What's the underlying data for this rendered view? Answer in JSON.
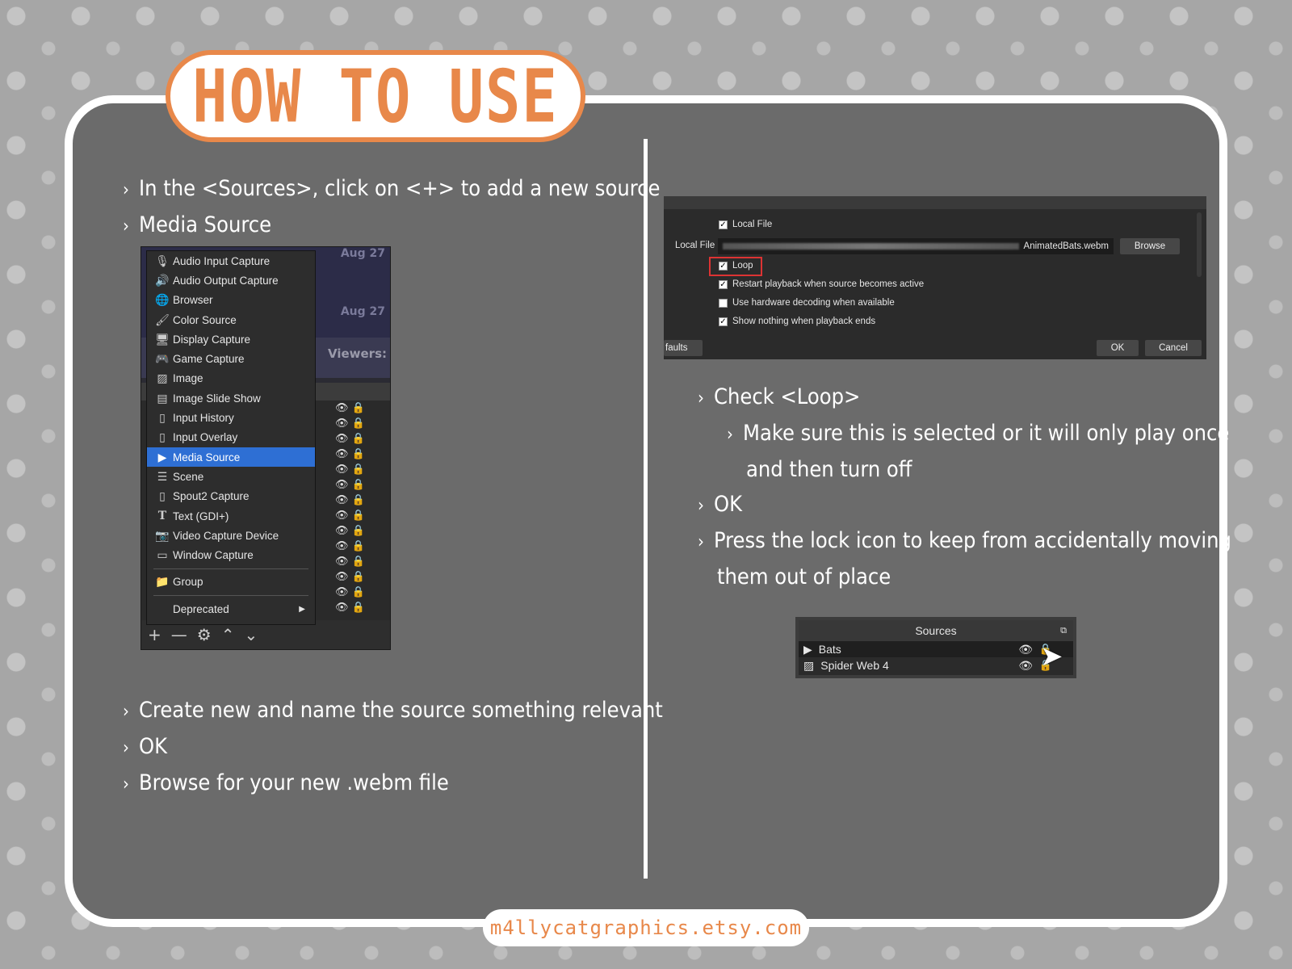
{
  "header": {
    "title": "HOW TO USE"
  },
  "colors": {
    "accent": "#e8884a",
    "panel": "#6b6b6b",
    "selection": "#2e6fd4",
    "highlight_box": "#d33333"
  },
  "left_steps_top": [
    "In the <Sources>, click on <+> to add a new source",
    "Media Source"
  ],
  "left_steps_bottom": [
    "Create new and name the source something relevant",
    "OK",
    "Browse for your new .webm file"
  ],
  "menu_shot": {
    "dates": [
      "Aug 27",
      "Aug 27"
    ],
    "viewers_label": "Viewers:",
    "items": [
      {
        "label": "Audio Input Capture",
        "icon": "microphone-icon"
      },
      {
        "label": "Audio Output Capture",
        "icon": "speaker-icon"
      },
      {
        "label": "Browser",
        "icon": "globe-icon"
      },
      {
        "label": "Color Source",
        "icon": "brush-icon"
      },
      {
        "label": "Display Capture",
        "icon": "monitor-icon"
      },
      {
        "label": "Game Capture",
        "icon": "gamepad-icon"
      },
      {
        "label": "Image",
        "icon": "image-icon"
      },
      {
        "label": "Image Slide Show",
        "icon": "slideshow-icon"
      },
      {
        "label": "Input History",
        "icon": "file-icon"
      },
      {
        "label": "Input Overlay",
        "icon": "file-icon"
      },
      {
        "label": "Media Source",
        "icon": "play-icon",
        "selected": true
      },
      {
        "label": "Scene",
        "icon": "list-icon"
      },
      {
        "label": "Spout2 Capture",
        "icon": "file-icon"
      },
      {
        "label": "Text (GDI+)",
        "icon": "text-icon"
      },
      {
        "label": "Video Capture Device",
        "icon": "camera-icon"
      },
      {
        "label": "Window Capture",
        "icon": "window-icon"
      }
    ],
    "group_label": "Group",
    "deprecated_label": "Deprecated"
  },
  "props_shot": {
    "local_file_checkbox": "Local File",
    "local_file_label": "Local File",
    "file_name": "AnimatedBats.webm",
    "browse_label": "Browse",
    "loop_label": "Loop",
    "restart_label": "Restart playback when source becomes active",
    "hw_decode_label": "Use hardware decoding when available",
    "show_nothing_label": "Show nothing when playback ends",
    "defaults_label": "faults",
    "ok_label": "OK",
    "cancel_label": "Cancel",
    "checked": {
      "local_file": true,
      "loop": true,
      "restart": true,
      "hw_decode": false,
      "show_nothing": true
    }
  },
  "right_steps": [
    {
      "text": "Check <Loop>",
      "kind": "step"
    },
    {
      "text": "Make sure this is selected or it will only play once",
      "kind": "sub"
    },
    {
      "text": "and then turn off",
      "kind": "cont2"
    },
    {
      "text": "OK",
      "kind": "step"
    },
    {
      "text": "Press the lock icon to keep from accidentally moving",
      "kind": "step"
    },
    {
      "text": "them out of place",
      "kind": "cont"
    }
  ],
  "sources_shot": {
    "header": "Sources",
    "rows": [
      {
        "label": "Bats",
        "icon": "play-icon"
      },
      {
        "label": "Spider Web 4",
        "icon": "image-icon"
      }
    ]
  },
  "footer": {
    "url": "m4llycatgraphics.etsy.com"
  }
}
